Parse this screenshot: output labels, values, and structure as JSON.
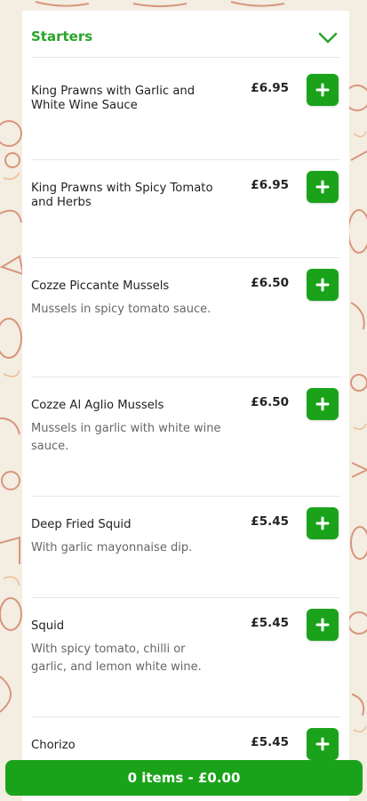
{
  "section": {
    "title": "Starters",
    "icon": "chevron-down-icon"
  },
  "items": [
    {
      "name": "King Prawns with Garlic and White Wine Sauce",
      "description": "",
      "price": "£6.95"
    },
    {
      "name": "King Prawns with Spicy Tomato and Herbs",
      "description": "",
      "price": "£6.95"
    },
    {
      "name": "Cozze Piccante Mussels",
      "description": "Mussels in spicy tomato sauce.",
      "price": "£6.50"
    },
    {
      "name": "Cozze Al Aglio Mussels",
      "description": "Mussels in garlic with white wine sauce.",
      "price": "£6.50"
    },
    {
      "name": "Deep Fried Squid",
      "description": "With garlic mayonnaise dip.",
      "price": "£5.45"
    },
    {
      "name": "Squid",
      "description": "With spicy tomato, chilli or garlic, and lemon white wine.",
      "price": "£5.45"
    },
    {
      "name": "Chorizo",
      "description": "",
      "price": "£5.45"
    }
  ],
  "basket": {
    "label": "0 items - £0.00"
  },
  "colors": {
    "accent": "#1aa31a",
    "title": "#2aa42a",
    "pattern": "#c0502a"
  }
}
